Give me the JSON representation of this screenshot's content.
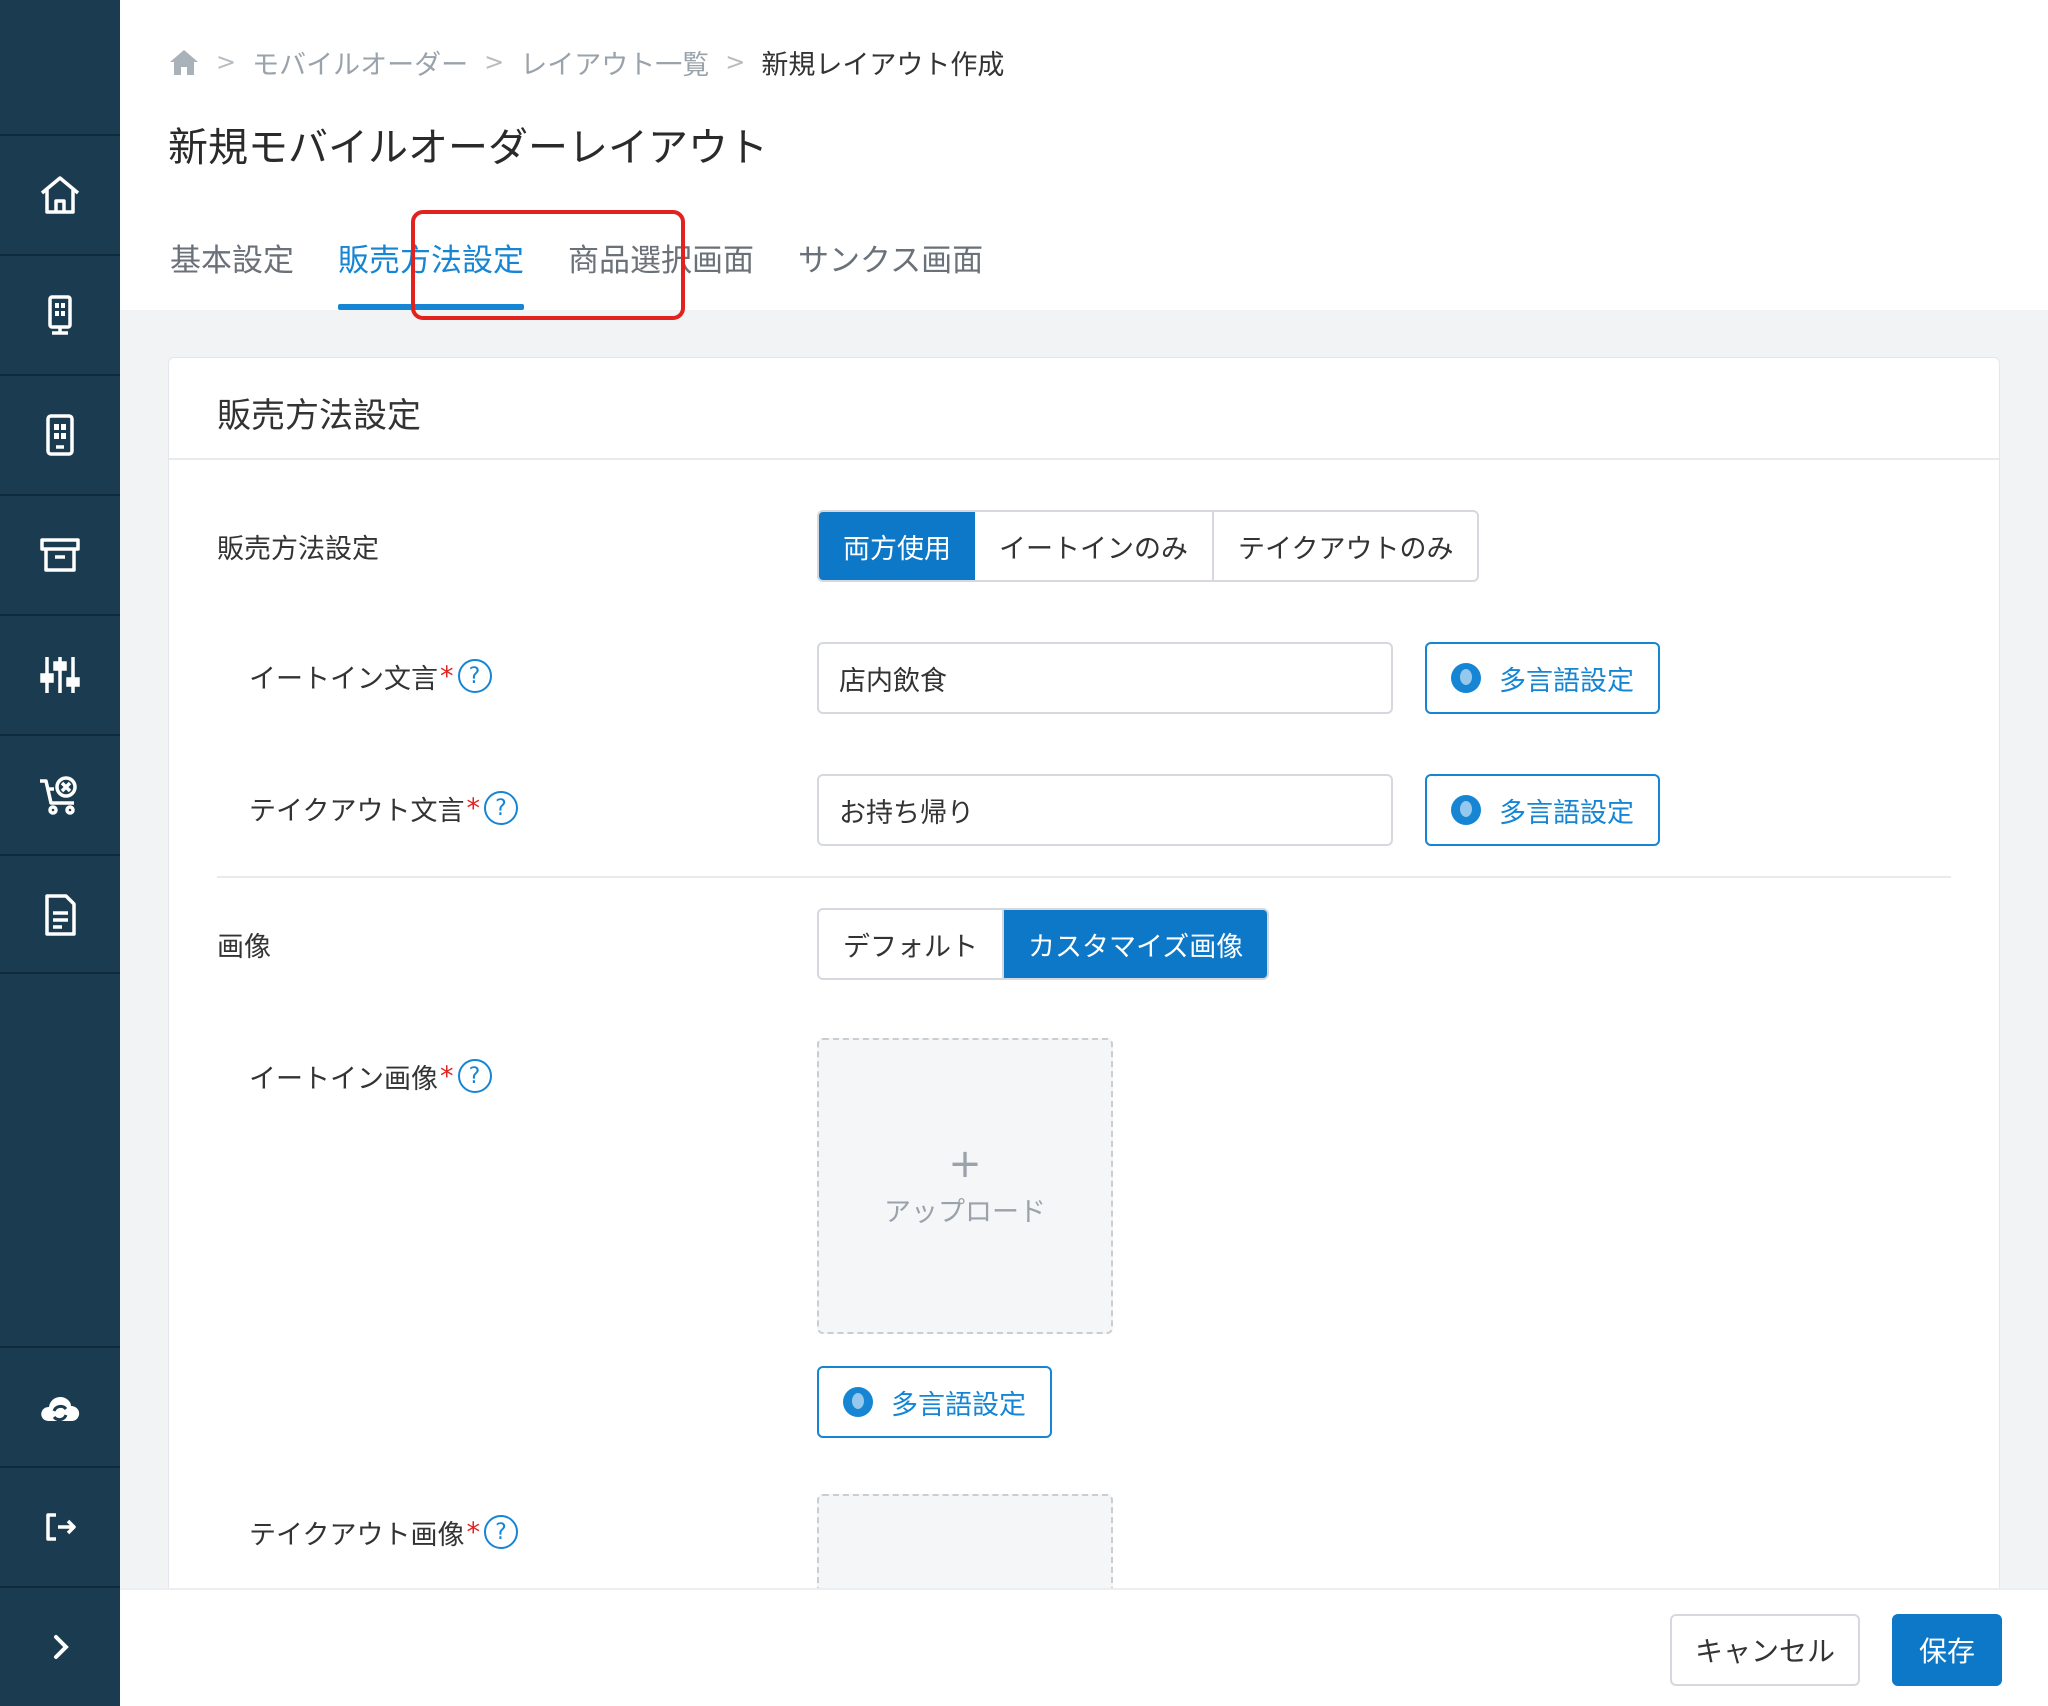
{
  "breadcrumb": {
    "items": [
      "モバイルオーダー",
      "レイアウト一覧"
    ],
    "current": "新規レイアウト作成",
    "separator": ">"
  },
  "page": {
    "title": "新規モバイルオーダーレイアウト"
  },
  "tabs": [
    {
      "label": "基本設定",
      "active": false
    },
    {
      "label": "販売方法設定",
      "active": true
    },
    {
      "label": "商品選択画面",
      "active": false
    },
    {
      "label": "サンクス画面",
      "active": false
    }
  ],
  "card": {
    "title": "販売方法設定"
  },
  "sales_method": {
    "label": "販売方法設定",
    "options": [
      "両方使用",
      "イートインのみ",
      "テイクアウトのみ"
    ],
    "selected": "両方使用"
  },
  "eat_in_text": {
    "label": "イートイン文言",
    "value": "店内飲食",
    "required_mark": "*",
    "help": "?"
  },
  "takeout_text": {
    "label": "テイクアウト文言",
    "value": "お持ち帰り",
    "required_mark": "*",
    "help": "?"
  },
  "multilang": {
    "label": "多言語設定"
  },
  "image": {
    "label": "画像",
    "options": [
      "デフォルト",
      "カスタマイズ画像"
    ],
    "selected": "カスタマイズ画像"
  },
  "eat_in_image": {
    "label": "イートイン画像",
    "required_mark": "*",
    "help": "?"
  },
  "takeout_image": {
    "label": "テイクアウト画像",
    "required_mark": "*",
    "help": "?"
  },
  "upload": {
    "plus": "+",
    "label": "アップロード"
  },
  "footer": {
    "cancel": "キャンセル",
    "save": "保存"
  },
  "sidebar": {
    "icons": [
      "home-icon",
      "kiosk-icon",
      "tablet-icon",
      "archive-icon",
      "sliders-icon",
      "cart-cancel-icon",
      "document-icon",
      "cloud-sync-icon",
      "logout-icon",
      "chevron-right-icon"
    ]
  },
  "colors": {
    "accent": "#1685d4",
    "primary_button": "#0e78c8",
    "sidebar": "#1b3c50",
    "highlight": "#e2221f"
  }
}
